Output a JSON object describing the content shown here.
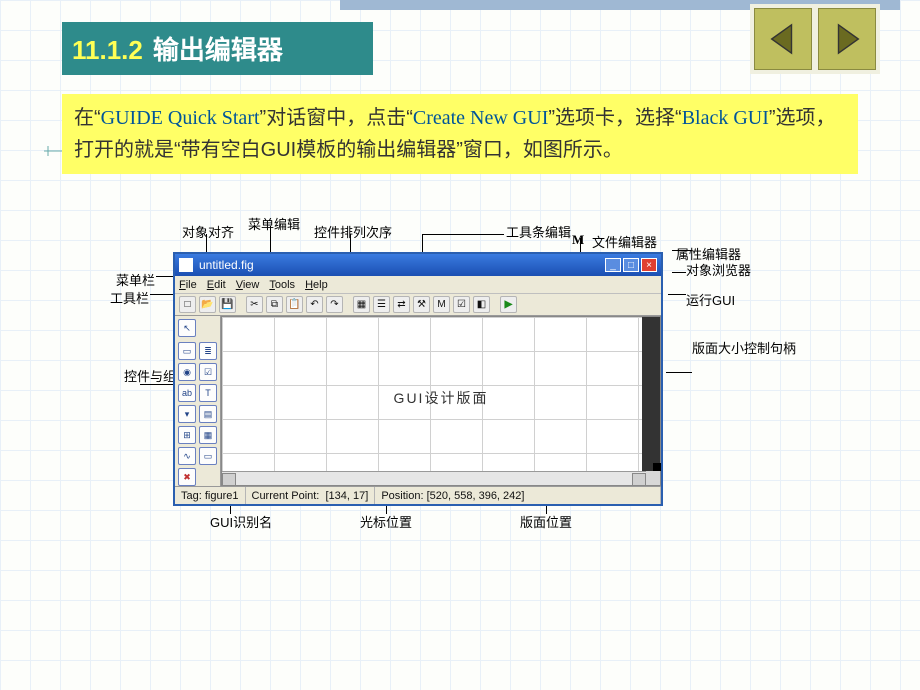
{
  "nav": {
    "prev": "previous-slide",
    "next": "next-slide"
  },
  "heading": {
    "number": "11.1.2",
    "title": "输出编辑器"
  },
  "desc": {
    "p1a": "在“",
    "p1_en1": "GUIDE Quick Start",
    "p1b": "”对话窗中，点击“",
    "p1_en2": "Create New GUI",
    "p1c": "”选项卡，选择“",
    "p1_en3": "Black GUI",
    "p1d": "”选项，打开的就是“带有空白GUI模板的输出编辑器”窗口，如图所示。"
  },
  "annotations": {
    "menu_editor": "菜单编辑",
    "object_align": "对象对齐",
    "control_order": "控件排列次序",
    "toolbar_editor": "工具条编辑",
    "mfile_editor": "文件编辑器",
    "prop_editor": "属性编辑器",
    "object_browser": "对象浏览器",
    "run_gui": "运行GUI",
    "menubar_label": "菜单栏",
    "toolbar_label": "工具栏",
    "layout_label": "GUI设计版面",
    "palette_label": "控件与组件",
    "resize_handle": "版面大小控制句柄",
    "gui_tag": "GUI识别名",
    "cursor_pos_label": "光标位置",
    "layout_pos_label": "版面位置",
    "m_symbol": "M"
  },
  "window": {
    "title": "untitled.fig",
    "menus": {
      "file": "File",
      "edit": "Edit",
      "view": "View",
      "tools": "Tools",
      "help": "Help"
    },
    "toolbar_icons": [
      "new",
      "open",
      "save",
      "",
      "cut",
      "copy",
      "paste",
      "undo",
      "redo",
      "",
      "align",
      "menu",
      "order",
      "toolb",
      "mfile",
      "prop",
      "obj",
      "",
      "run"
    ],
    "canvas_label": "GUI设计版面",
    "status": {
      "tag_label": "Tag:",
      "tag_value": "figure1",
      "cp_label": "Current Point:",
      "cp_value": "[134, 17]",
      "pos_label": "Position:",
      "pos_value": "[520, 558, 396, 242]"
    },
    "palette": [
      "▣",
      "◎",
      "◉",
      "≡",
      "▭",
      "≔",
      "Txt",
      "□",
      "⊞",
      "▦",
      "|≈|",
      "▭",
      "✖"
    ]
  }
}
